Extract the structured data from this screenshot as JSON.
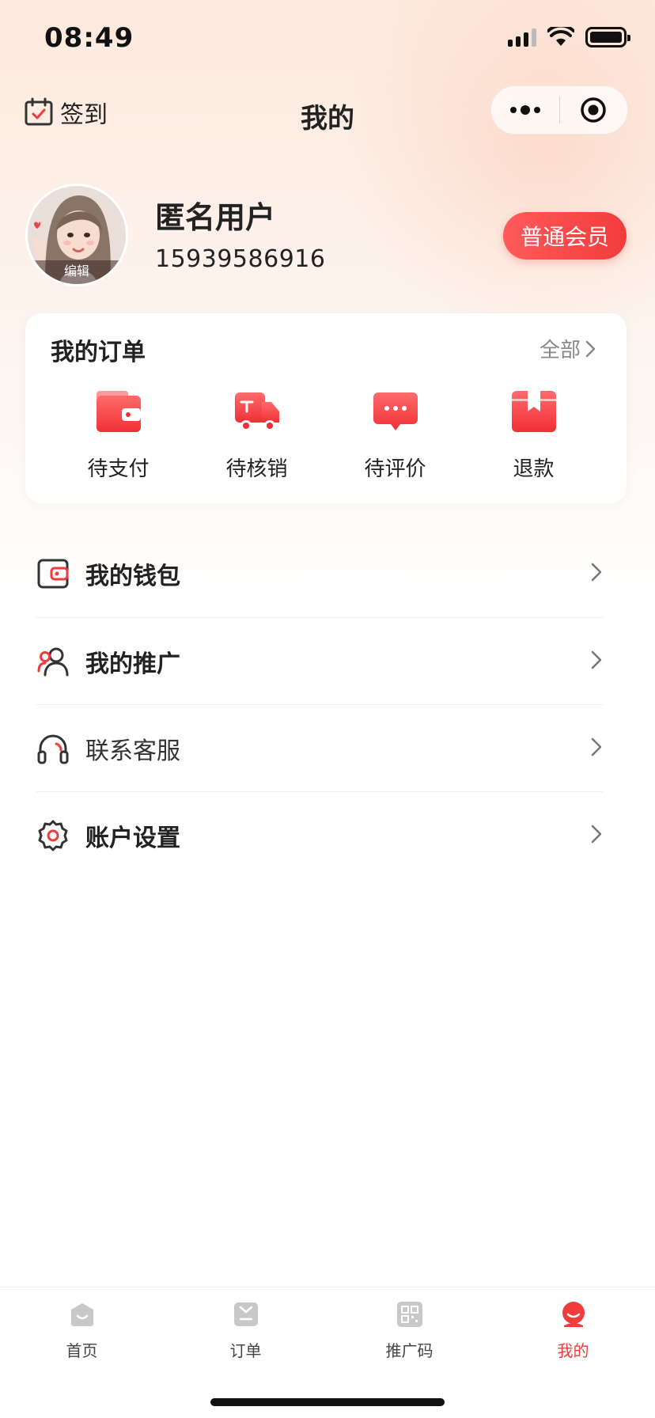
{
  "status_bar": {
    "time": "08:49"
  },
  "nav": {
    "checkin_label": "签到",
    "title": "我的"
  },
  "profile": {
    "edit_label": "编辑",
    "name": "匿名用户",
    "phone": "15939586916",
    "member_label": "普通会员"
  },
  "orders": {
    "title": "我的订单",
    "all_label": "全部",
    "items": [
      {
        "label": "待支付",
        "icon": "wallet-icon"
      },
      {
        "label": "待核销",
        "icon": "truck-icon"
      },
      {
        "label": "待评价",
        "icon": "chat-bubble-icon"
      },
      {
        "label": "退款",
        "icon": "box-icon"
      }
    ]
  },
  "menu": {
    "items": [
      {
        "label": "我的钱包",
        "icon": "wallet-outline-icon"
      },
      {
        "label": "我的推广",
        "icon": "users-icon"
      },
      {
        "label": "联系客服",
        "icon": "headset-icon"
      },
      {
        "label": "账户设置",
        "icon": "settings-gear-icon"
      }
    ]
  },
  "tabs": [
    {
      "label": "首页",
      "icon": "home-icon"
    },
    {
      "label": "订单",
      "icon": "order-icon"
    },
    {
      "label": "推广码",
      "icon": "qr-code-icon"
    },
    {
      "label": "我的",
      "icon": "profile-icon",
      "active": true
    }
  ],
  "colors": {
    "accent": "#f23c3c",
    "text": "#222222",
    "muted": "#888888"
  }
}
